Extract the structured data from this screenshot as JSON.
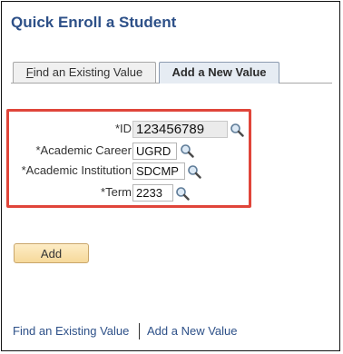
{
  "page": {
    "title": "Quick Enroll a Student"
  },
  "tabs": {
    "find": {
      "label_first": "F",
      "label_rest": "ind an Existing Value"
    },
    "add": {
      "label": "Add a New Value"
    }
  },
  "form": {
    "id": {
      "label": "*ID",
      "value": "123456789"
    },
    "career": {
      "label": "*Academic Career",
      "value": "UGRD"
    },
    "institution": {
      "label": "*Academic Institution",
      "value": "SDCMP"
    },
    "term": {
      "label": "*Term",
      "value": "2233"
    }
  },
  "actions": {
    "add_label": "Add"
  },
  "footer": {
    "find_link": "Find an Existing Value",
    "add_link": "Add a New Value"
  },
  "colors": {
    "title": "#2d5088",
    "highlight": "#e0453a",
    "button": "#f6d99b"
  },
  "icons": {
    "lookup": "magnifier-lookup-icon"
  }
}
